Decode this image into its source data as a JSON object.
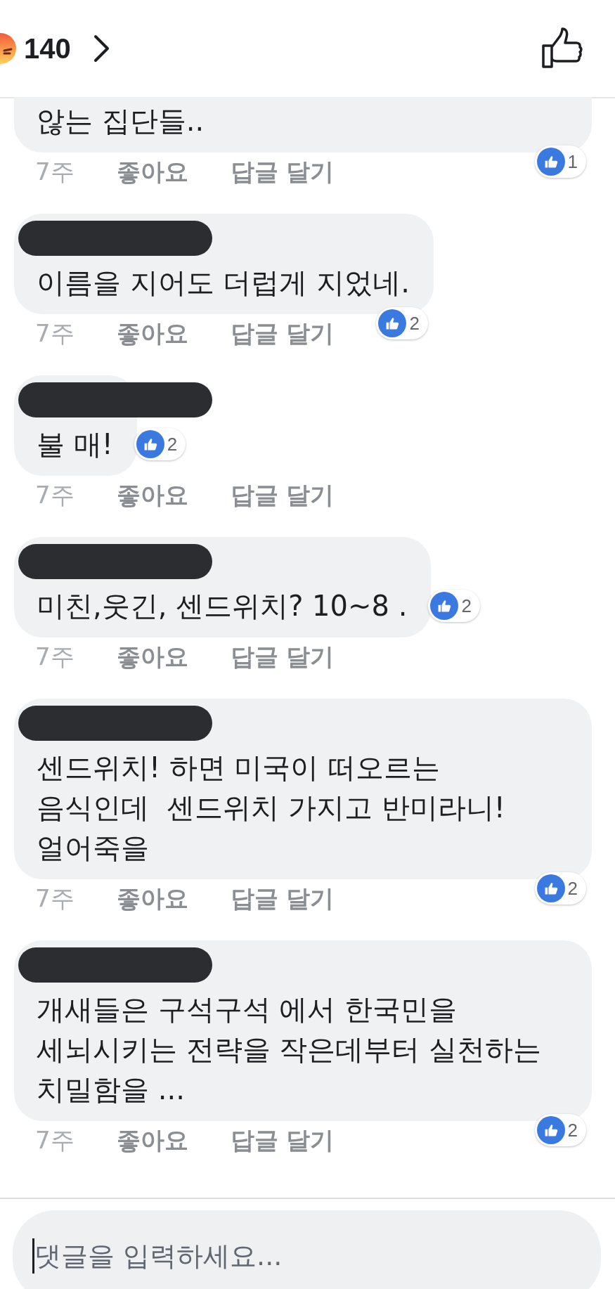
{
  "header": {
    "reaction_count": "140"
  },
  "comments": [
    {
      "kind": "continued",
      "text": "않는 집단들..",
      "reactions": {
        "kind": "corner",
        "count": "1"
      },
      "meta": {
        "time": "7주",
        "like": "좋아요",
        "reply": "답글 달기"
      }
    },
    {
      "kind": "full",
      "text": "이름을 지어도 더럽게 지었네.",
      "reactions": {
        "kind": "corner",
        "count": "2"
      },
      "meta": {
        "time": "7주",
        "like": "좋아요",
        "reply": "답글 달기"
      }
    },
    {
      "kind": "full",
      "text": "불 매!",
      "reactions": {
        "kind": "beside",
        "count": "2"
      },
      "meta": {
        "time": "7주",
        "like": "좋아요",
        "reply": "답글 달기"
      }
    },
    {
      "kind": "full",
      "text": "미친,웃긴, 센드위치? 10~8 .",
      "reactions": {
        "kind": "beside",
        "count": "2"
      },
      "meta": {
        "time": "7주",
        "like": "좋아요",
        "reply": "답글 달기"
      }
    },
    {
      "kind": "full",
      "text": "센드위치! 하면 미국이 떠오르는\n음식인데  센드위치 가지고 반미라니!\n얼어죽을",
      "reactions": {
        "kind": "corner",
        "count": "2"
      },
      "meta": {
        "time": "7주",
        "like": "좋아요",
        "reply": "답글 달기"
      }
    },
    {
      "kind": "full",
      "text": "개새들은 구석구석 에서 한국민을\n세뇌시키는 전략을 작은데부터 실천하는\n치밀함을 ...",
      "reactions": {
        "kind": "corner",
        "count": "2"
      },
      "meta": {
        "time": "7주",
        "like": "좋아요",
        "reply": "답글 달기"
      }
    }
  ],
  "comment_box": {
    "placeholder": "댓글을 입력하세요...",
    "focused": true
  }
}
